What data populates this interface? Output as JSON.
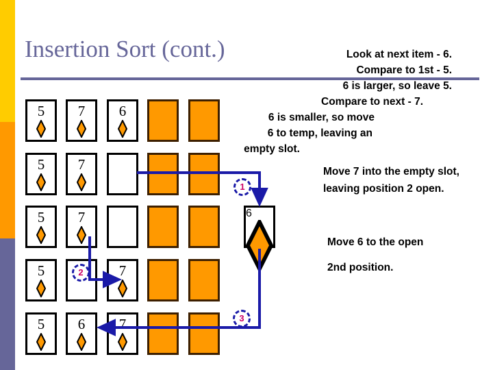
{
  "slide": {
    "title": "Insertion Sort (cont.)",
    "accent_title_color": "#666699",
    "accent_card_color": "#ff9900",
    "marker_ring_color": "#1a1aa8",
    "marker_text_color": "#cc0066",
    "arrow_color": "#1a1aa8"
  },
  "sidebar": {
    "bars": [
      {
        "name": "yellow",
        "color": "#ffcc00"
      },
      {
        "name": "orange",
        "color": "#ff9900"
      },
      {
        "name": "slate",
        "color": "#666699"
      }
    ]
  },
  "narration": {
    "main_lines": [
      "Look at next item - 6.",
      "Compare to 1st - 5.",
      "6 is larger, so leave 5.",
      "Compare to next - 7.",
      "6 is smaller, so move",
      "6 to temp, leaving an",
      "empty slot."
    ],
    "move_7_text": "Move 7 into the empty slot, leaving position 2 open.",
    "move_6_text": "Move 6 to the open",
    "second_position_text": "2nd position."
  },
  "grid": {
    "columns": 5,
    "rows": [
      [
        {
          "type": "card",
          "value": "5"
        },
        {
          "type": "card",
          "value": "7"
        },
        {
          "type": "card",
          "value": "6"
        },
        {
          "type": "filled",
          "value": ""
        },
        {
          "type": "filled",
          "value": ""
        }
      ],
      [
        {
          "type": "card",
          "value": "5"
        },
        {
          "type": "card",
          "value": "7"
        },
        {
          "type": "empty",
          "value": ""
        },
        {
          "type": "filled",
          "value": ""
        },
        {
          "type": "filled",
          "value": ""
        }
      ],
      [
        {
          "type": "card",
          "value": "5"
        },
        {
          "type": "card",
          "value": "7"
        },
        {
          "type": "empty",
          "value": ""
        },
        {
          "type": "filled",
          "value": ""
        },
        {
          "type": "filled",
          "value": ""
        }
      ],
      [
        {
          "type": "card",
          "value": "5"
        },
        {
          "type": "empty",
          "value": ""
        },
        {
          "type": "card",
          "value": "7"
        },
        {
          "type": "filled",
          "value": ""
        },
        {
          "type": "filled",
          "value": ""
        }
      ],
      [
        {
          "type": "card",
          "value": "5"
        },
        {
          "type": "card",
          "value": "6"
        },
        {
          "type": "card",
          "value": "7"
        },
        {
          "type": "filled",
          "value": ""
        },
        {
          "type": "filled",
          "value": ""
        }
      ]
    ]
  },
  "temp_card": {
    "value": "6"
  },
  "markers": [
    {
      "id": "1",
      "label": "1"
    },
    {
      "id": "2",
      "label": "2"
    },
    {
      "id": "3",
      "label": "3"
    }
  ]
}
